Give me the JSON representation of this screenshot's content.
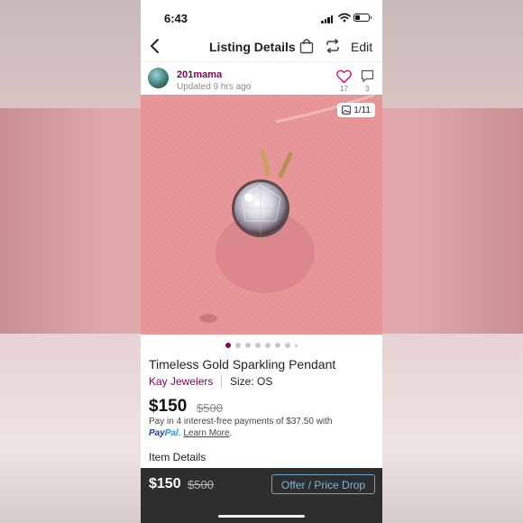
{
  "status_bar": {
    "time": "6:43"
  },
  "nav": {
    "title": "Listing Details",
    "edit_label": "Edit"
  },
  "seller": {
    "username": "201mama",
    "updated": "Updated 9 hrs ago",
    "likes": "17",
    "comments": "3"
  },
  "photo": {
    "counter": "1/11",
    "total_dots": 8,
    "active_dot": 0
  },
  "listing": {
    "title": "Timeless Gold Sparkling Pendant",
    "brand": "Kay Jewelers",
    "size": "Size: OS",
    "price": "$150",
    "original_price": "$500",
    "installments": "Pay in 4 interest-free payments of $37.50 with",
    "paypal_pay": "Pay",
    "paypal_pal": "Pal",
    "paypal_suffix": ".",
    "learn_more": "Learn More",
    "learn_more_suffix": ".",
    "details_heading": "Item Details"
  },
  "bottom_bar": {
    "price": "$150",
    "original_price": "$500",
    "offer_label": "Offer / Price Drop"
  },
  "colors": {
    "accent": "#7f0353",
    "offer_blue": "#7fb6dc",
    "bottom_bar": "#2e2e2e"
  },
  "icons": [
    "back-chevron-icon",
    "shopping-bag-icon",
    "share-icon",
    "heart-icon",
    "comment-icon",
    "image-icon",
    "signal-icon",
    "wifi-icon",
    "battery-icon"
  ]
}
